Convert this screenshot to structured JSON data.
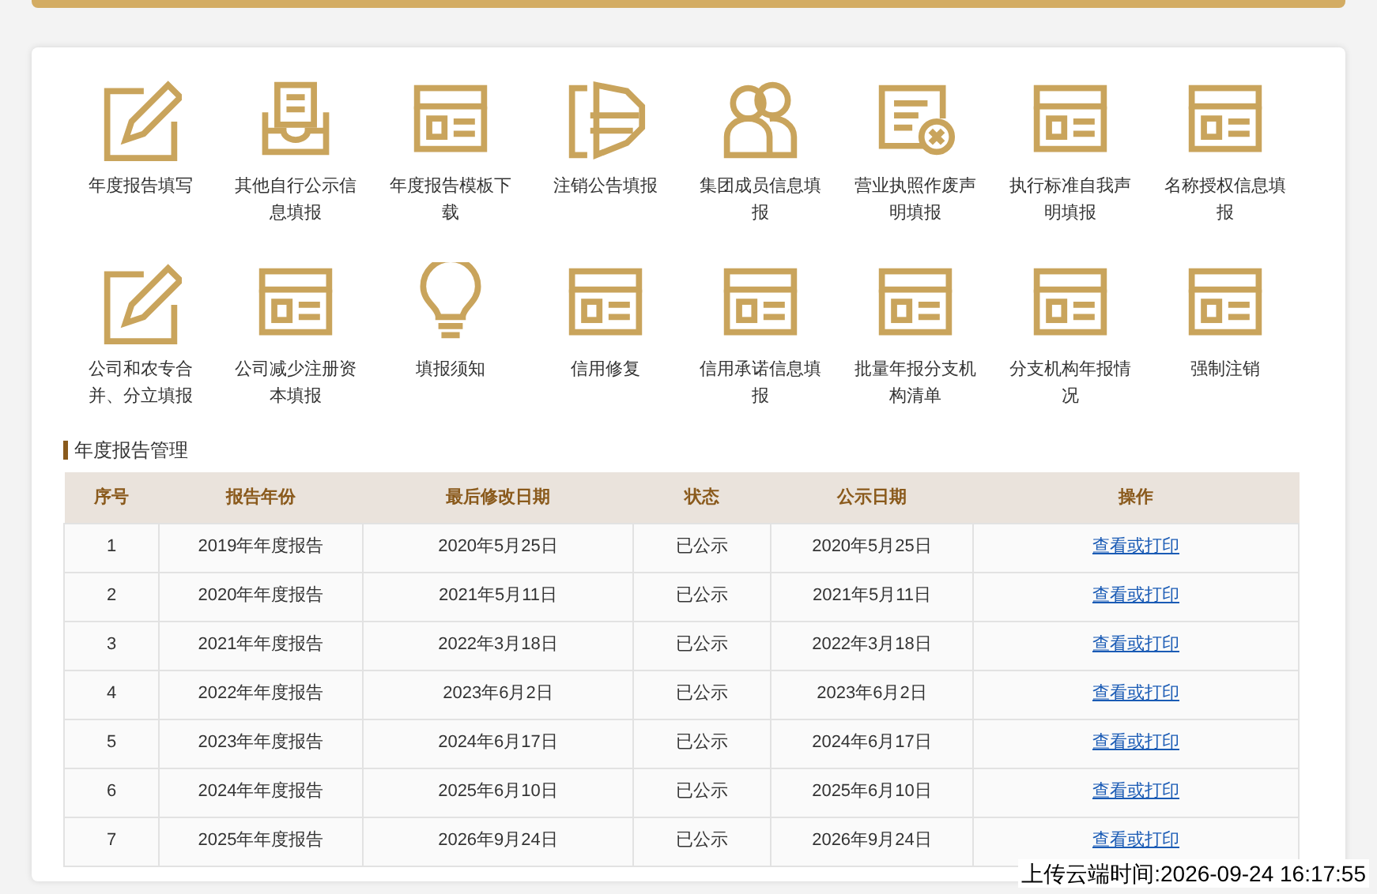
{
  "shortcuts": [
    {
      "kind": "pencil",
      "label": "年度报告填写"
    },
    {
      "kind": "inbox",
      "label": "其他自行公示信息填报"
    },
    {
      "kind": "form",
      "label": "年度报告模板下载"
    },
    {
      "kind": "folded",
      "label": "注销公告填报"
    },
    {
      "kind": "people",
      "label": "集团成员信息填报"
    },
    {
      "kind": "doc-x",
      "label": "营业执照作废声明填报"
    },
    {
      "kind": "form",
      "label": "执行标准自我声明填报"
    },
    {
      "kind": "form",
      "label": "名称授权信息填报"
    },
    {
      "kind": "pencil",
      "label": "公司和农专合并、分立填报"
    },
    {
      "kind": "form",
      "label": "公司减少注册资本填报"
    },
    {
      "kind": "bulb",
      "label": "填报须知"
    },
    {
      "kind": "form",
      "label": "信用修复"
    },
    {
      "kind": "form",
      "label": "信用承诺信息填报"
    },
    {
      "kind": "form",
      "label": "批量年报分支机构清单"
    },
    {
      "kind": "form",
      "label": "分支机构年报情况"
    },
    {
      "kind": "form",
      "label": "强制注销"
    }
  ],
  "section_title": "年度报告管理",
  "table": {
    "columns": [
      "序号",
      "报告年份",
      "最后修改日期",
      "状态",
      "公示日期",
      "操作"
    ],
    "rows": [
      [
        "1",
        "2019年年度报告",
        "2020年5月25日",
        "已公示",
        "2020年5月25日",
        "查看或打印"
      ],
      [
        "2",
        "2020年年度报告",
        "2021年5月11日",
        "已公示",
        "2021年5月11日",
        "查看或打印"
      ],
      [
        "3",
        "2021年年度报告",
        "2022年3月18日",
        "已公示",
        "2022年3月18日",
        "查看或打印"
      ],
      [
        "4",
        "2022年年度报告",
        "2023年6月2日",
        "已公示",
        "2023年6月2日",
        "查看或打印"
      ],
      [
        "5",
        "2023年年度报告",
        "2024年6月17日",
        "已公示",
        "2024年6月17日",
        "查看或打印"
      ],
      [
        "6",
        "2024年年度报告",
        "2025年6月10日",
        "已公示",
        "2025年6月10日",
        "查看或打印"
      ],
      [
        "7",
        "2025年年度报告",
        "2026年9月24日",
        "已公示",
        "2026年9月24日",
        "查看或打印"
      ]
    ]
  },
  "upload_time": "上传云端时间:2026-09-24 16:17:55"
}
